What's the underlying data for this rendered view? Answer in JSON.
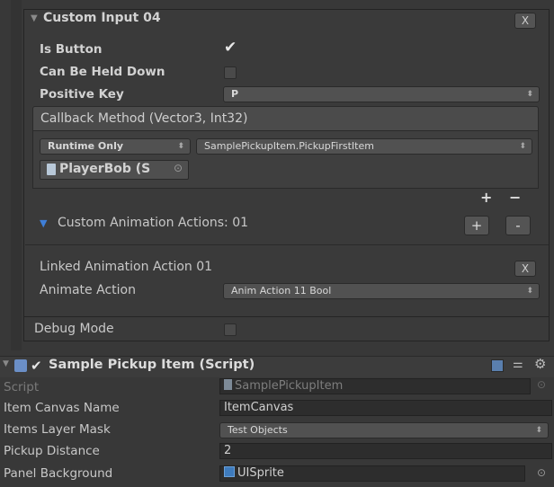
{
  "custom_input": {
    "title": "Custom Input 04",
    "close_label": "X",
    "is_button_label": "Is Button",
    "is_button_checked": true,
    "held_down_label": "Can Be Held Down",
    "held_down_checked": false,
    "positive_key_label": "Positive Key",
    "positive_key_value": "P"
  },
  "callback": {
    "header": "Callback Method (Vector3, Int32)",
    "mode_value": "Runtime Only",
    "method_value": "SamplePickupItem.PickupFirstItem",
    "object_value": "PlayerBob (S",
    "plus_label": "+",
    "minus_label": "−"
  },
  "animation_actions": {
    "label": "Custom Animation Actions: 01",
    "plus_label": "+",
    "minus_label": "-"
  },
  "linked_action": {
    "title": "Linked Animation Action 01",
    "close_label": "X",
    "animate_label": "Animate Action",
    "animate_value": "Anim Action 11 Bool"
  },
  "debug": {
    "label": "Debug Mode",
    "checked": false
  },
  "component": {
    "title": "Sample Pickup Item (Script)",
    "script_label": "Script",
    "script_value": "SamplePickupItem",
    "rows": [
      {
        "label": "Item Canvas Name",
        "value": "ItemCanvas"
      },
      {
        "label": "Items Layer Mask",
        "value": "Test Objects"
      },
      {
        "label": "Pickup Distance",
        "value": "2"
      },
      {
        "label": "Panel Background",
        "value": "UISprite"
      }
    ]
  },
  "colors": {
    "background": "#383838",
    "accent_blue": "#3f7fd8",
    "field": "#2d2d2d"
  }
}
